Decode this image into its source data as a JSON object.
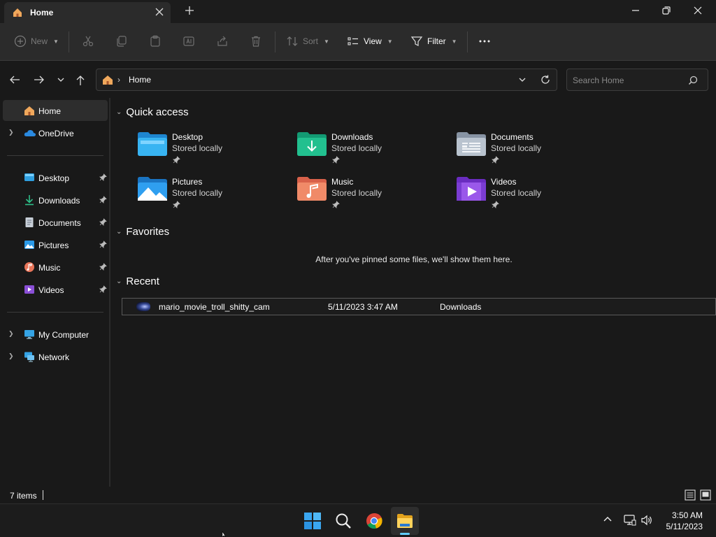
{
  "window": {
    "tab_title": "Home",
    "icons": {
      "tab": "home-icon",
      "close_tab": "close-icon",
      "new_tab": "plus-icon",
      "minimize": "minimize-icon",
      "restore": "restore-icon",
      "close": "close-icon"
    }
  },
  "toolbar": {
    "new_label": "New",
    "sort_label": "Sort",
    "view_label": "View",
    "filter_label": "Filter",
    "icons": [
      "cut-icon",
      "copy-icon",
      "paste-icon",
      "rename-icon",
      "share-icon",
      "delete-icon",
      "more-icon"
    ]
  },
  "address": {
    "breadcrumb": "Home",
    "search_placeholder": "Search Home"
  },
  "sidebar": {
    "home": {
      "label": "Home",
      "icon": "home-icon"
    },
    "onedrive": {
      "label": "OneDrive",
      "icon": "cloud-icon"
    },
    "pinned": [
      {
        "label": "Desktop",
        "icon": "desktop-icon"
      },
      {
        "label": "Downloads",
        "icon": "download-icon"
      },
      {
        "label": "Documents",
        "icon": "document-icon"
      },
      {
        "label": "Pictures",
        "icon": "picture-icon"
      },
      {
        "label": "Music",
        "icon": "music-icon"
      },
      {
        "label": "Videos",
        "icon": "video-icon"
      }
    ],
    "my_computer": {
      "label": "My Computer",
      "icon": "computer-icon"
    },
    "network": {
      "label": "Network",
      "icon": "network-icon"
    }
  },
  "main": {
    "quick_access": {
      "title": "Quick access",
      "items": [
        {
          "name": "Desktop",
          "status": "Stored locally"
        },
        {
          "name": "Downloads",
          "status": "Stored locally"
        },
        {
          "name": "Documents",
          "status": "Stored locally"
        },
        {
          "name": "Pictures",
          "status": "Stored locally"
        },
        {
          "name": "Music",
          "status": "Stored locally"
        },
        {
          "name": "Videos",
          "status": "Stored locally"
        }
      ]
    },
    "favorites": {
      "title": "Favorites",
      "empty_text": "After you've pinned some files, we'll show them here."
    },
    "recent": {
      "title": "Recent",
      "files": [
        {
          "name": "mario_movie_troll_shitty_cam",
          "date": "5/11/2023 3:47 AM",
          "location": "Downloads"
        }
      ]
    }
  },
  "status": {
    "item_count": "7 items"
  },
  "taskbar": {
    "time": "3:50 AM",
    "date": "5/11/2023",
    "apps": [
      "windows-start-icon",
      "search-icon",
      "chrome-icon",
      "file-explorer-icon"
    ]
  },
  "colors": {
    "background": "#191919",
    "toolbar": "#2b2b2b",
    "accent": "#60cdff"
  }
}
